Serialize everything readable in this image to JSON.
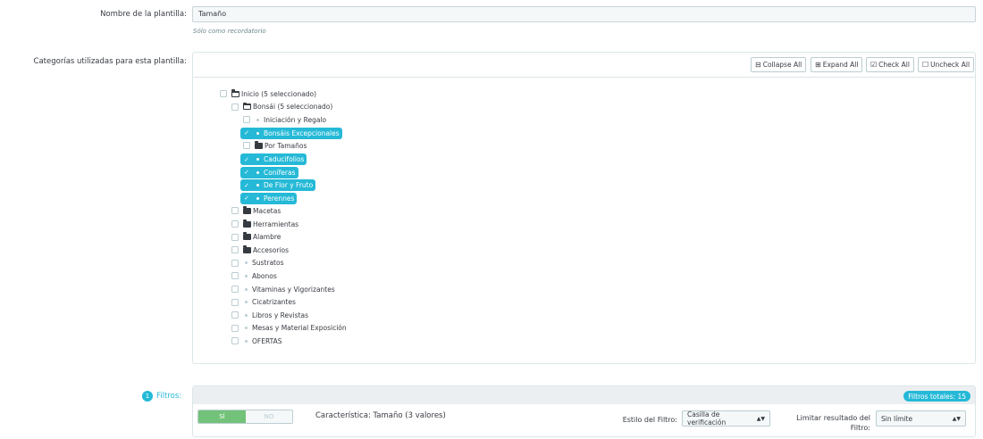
{
  "template_name": {
    "label": "Nombre de la plantilla:",
    "value": "Tamaño",
    "hint": "Sólo como recordatorio"
  },
  "categories": {
    "label": "Categorías utilizadas para esta plantilla:",
    "toolbar": {
      "collapse": "Collapse All",
      "expand": "Expand All",
      "check": "Check All",
      "uncheck": "Uncheck All"
    },
    "tree": [
      {
        "label": "Inicio (5 seleccionado)",
        "icon": "folder-open-icon",
        "level": 0,
        "selected": false
      },
      {
        "label": "Bonsái (5 seleccionado)",
        "icon": "folder-open-icon",
        "level": 1,
        "selected": false
      },
      {
        "label": "Iniciación y Regalo",
        "icon": "dot-icon",
        "level": 2,
        "selected": false
      },
      {
        "label": "Bonsáis Excepcionales",
        "icon": "dot-icon",
        "level": 2,
        "selected": true
      },
      {
        "label": "Por Tamaños",
        "icon": "folder-icon",
        "level": 2,
        "selected": false
      },
      {
        "label": "Caducifolios",
        "icon": "dot-icon",
        "level": 2,
        "selected": true
      },
      {
        "label": "Coníferas",
        "icon": "dot-icon",
        "level": 2,
        "selected": true
      },
      {
        "label": "De Flor y Fruto",
        "icon": "dot-icon",
        "level": 2,
        "selected": true
      },
      {
        "label": "Perennes",
        "icon": "dot-icon",
        "level": 2,
        "selected": true
      },
      {
        "label": "Macetas",
        "icon": "folder-icon",
        "level": 1,
        "selected": false
      },
      {
        "label": "Herramientas",
        "icon": "folder-icon",
        "level": 1,
        "selected": false
      },
      {
        "label": "Alambre",
        "icon": "folder-icon",
        "level": 1,
        "selected": false
      },
      {
        "label": "Accesorios",
        "icon": "folder-icon",
        "level": 1,
        "selected": false
      },
      {
        "label": "Sustratos",
        "icon": "dot-icon",
        "level": 1,
        "selected": false
      },
      {
        "label": "Abonos",
        "icon": "dot-icon",
        "level": 1,
        "selected": false
      },
      {
        "label": "Vitaminas y Vigorizantes",
        "icon": "dot-icon",
        "level": 1,
        "selected": false
      },
      {
        "label": "Cicatrizantes",
        "icon": "dot-icon",
        "level": 1,
        "selected": false
      },
      {
        "label": "Libros y Revistas",
        "icon": "dot-icon",
        "level": 1,
        "selected": false
      },
      {
        "label": "Mesas y Material Exposición",
        "icon": "dot-icon",
        "level": 1,
        "selected": false
      },
      {
        "label": "OFERTAS",
        "icon": "dot-icon",
        "level": 1,
        "selected": false
      }
    ]
  },
  "filters": {
    "step": "1",
    "label": "Filtros:",
    "total": "Filtros totales: 15",
    "row": {
      "switch_on": "SÍ",
      "switch_off": "NO",
      "feature": "Característica: Tamaño (3 valores)",
      "style_label": "Estilo del Filtro:",
      "style_value": "Casilla de verificación",
      "limit_label_1": "Limitar resultado del",
      "limit_label_2": "Filtro:",
      "limit_value": "Sin límite"
    }
  },
  "colors": {
    "accent": "#25b9d7",
    "switch_on": "#72c279",
    "text": "#363a41"
  }
}
